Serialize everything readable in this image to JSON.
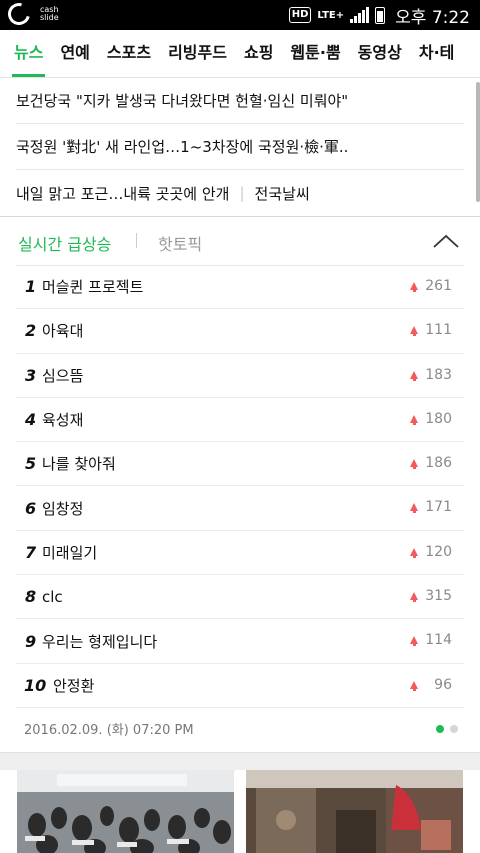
{
  "status": {
    "app_logo_text_1": "cash",
    "app_logo_text_2": "slide",
    "hd": "HD",
    "network": "LTE+",
    "time": "오후 7:22"
  },
  "nav": {
    "tabs": [
      "뉴스",
      "연예",
      "스포츠",
      "리빙푸드",
      "쇼핑",
      "웹툰·뿜",
      "동영상",
      "차·테"
    ],
    "active_index": 0
  },
  "headlines": [
    {
      "text": "보건당국 \"지카 발생국 다녀왔다면 헌혈·임신 미뤄야\""
    },
    {
      "text": "국정원 '對北' 새 라인업…1~3차장에 국정원·檢·軍.."
    },
    {
      "text": "내일 맑고 포근…내륙 곳곳에 안개",
      "extra": "전국날씨"
    }
  ],
  "trending": {
    "tab_active": "실시간 급상승",
    "tab_inactive": "핫토픽",
    "items": [
      {
        "rank": "1",
        "keyword": "머슬퀸 프로젝트",
        "count": "261"
      },
      {
        "rank": "2",
        "keyword": "아육대",
        "count": "111"
      },
      {
        "rank": "3",
        "keyword": "심으뜸",
        "count": "183"
      },
      {
        "rank": "4",
        "keyword": "육성재",
        "count": "180"
      },
      {
        "rank": "5",
        "keyword": "나를 찾아줘",
        "count": "186"
      },
      {
        "rank": "6",
        "keyword": "임창정",
        "count": "171"
      },
      {
        "rank": "7",
        "keyword": "미래일기",
        "count": "120"
      },
      {
        "rank": "8",
        "keyword": "clc",
        "count": "315"
      },
      {
        "rank": "9",
        "keyword": "우리는 형제입니다",
        "count": "114"
      },
      {
        "rank": "10",
        "keyword": "안정환",
        "count": "96"
      }
    ],
    "timestamp": "2016.02.09. (화) 07:20 PM",
    "page_dots": 2,
    "active_dot": 0
  },
  "colors": {
    "accent": "#1fba57",
    "up_arrow": "#f25b5b"
  }
}
